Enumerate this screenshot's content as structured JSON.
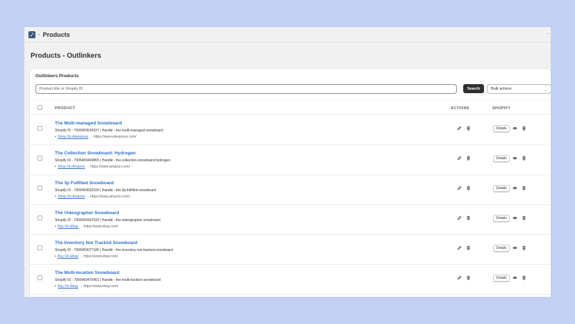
{
  "topbar": {
    "breadcrumb": "Products",
    "more": "···"
  },
  "page": {
    "title": "Products - Outlinkers"
  },
  "card": {
    "title": "Outlinkers Products",
    "search_placeholder": "Product title or Shopify ID",
    "search_button": "Search",
    "bulk_actions": "Bulk actions"
  },
  "table": {
    "columns": {
      "product": "PRODUCT",
      "actions": "ACTIONS",
      "shopify": "SHOPIFY"
    },
    "details_label": "Details",
    "rows": [
      {
        "title": "The Multi-managed Snowboard",
        "meta": "Shopify ID - 7905459535937 | Handle - the-multi-managed-snowboard",
        "shop": "Shop On Aliexpress",
        "url": "→ https://www.aliexpress.com/"
      },
      {
        "title": "The Collection Snowboard: Hydrogen",
        "meta": "Shopify ID - 7905459404865 | Handle - the-collection-snowboard-hydrogen",
        "shop": "Shop On Amazon",
        "url": "→ https://www.amazon.com/"
      },
      {
        "title": "The 3p Fulfilled Snowboard",
        "meta": "Shopify ID - 7905459503169 | Handle - the-3p-fulfilled-snowboard",
        "shop": "Shop On Amazon",
        "url": "→ https://www.amazon.com/"
      },
      {
        "title": "The Videographer Snowboard",
        "meta": "Shopify ID - 7905459437633 | Handle - the-videographer-snowboard",
        "shop": "Buy On Ebay",
        "url": "→ https://www.ebay.com/"
      },
      {
        "title": "The Inventory Not Tracked Snowboard",
        "meta": "Shopify ID - 7905459077185 | Handle - the-inventory-not-tracked-snowboard",
        "shop": "Buy On Ebay",
        "url": "→ https://www.ebay.com/"
      },
      {
        "title": "The Multi-location Snowboard",
        "meta": "Shopify ID - 7905459470401 | Handle - the-multi-location-snowboard",
        "shop": "Buy On Ebay",
        "url": "→ https://www.ebay.com/"
      }
    ]
  },
  "colors": {
    "background": "#c3cff3",
    "link": "#2c6ecb",
    "primary_button": "#303030"
  },
  "icons": [
    "products-app-icon",
    "edit-icon",
    "delete-icon",
    "view-icon"
  ]
}
